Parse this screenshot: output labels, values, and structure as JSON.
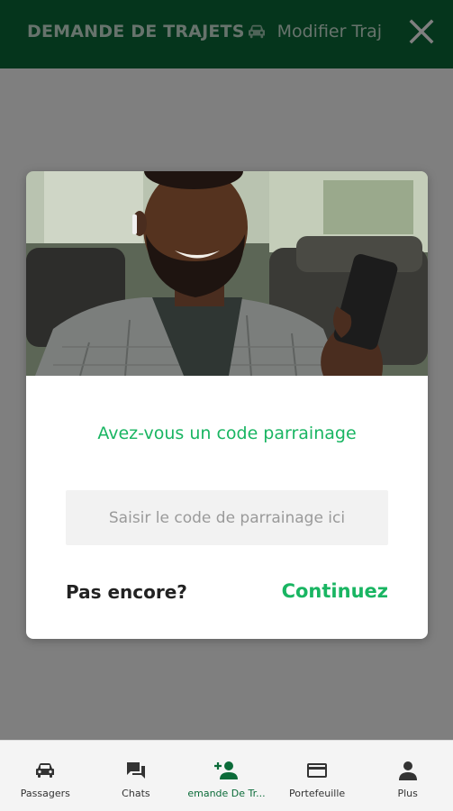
{
  "header": {
    "tab_active": "DEMANDE DE TRAJETS",
    "tab_next": "Modifier Traj",
    "bg_color": "#0b6b39"
  },
  "dialog": {
    "title": "Avez-vous un code parrainage",
    "input_placeholder": "Saisir le code de parrainage ici",
    "input_value": "",
    "dismiss_label": "Pas encore?",
    "continue_label": "Continuez",
    "accent_color": "#19b562"
  },
  "nav": {
    "items": [
      {
        "label": "Passagers",
        "icon": "car-icon"
      },
      {
        "label": "Chats",
        "icon": "chat-icon"
      },
      {
        "label": "emande De Tr...",
        "icon": "add-person-icon"
      },
      {
        "label": "Portefeuille",
        "icon": "wallet-icon"
      },
      {
        "label": "Plus",
        "icon": "person-icon"
      }
    ],
    "active_index": 2
  }
}
